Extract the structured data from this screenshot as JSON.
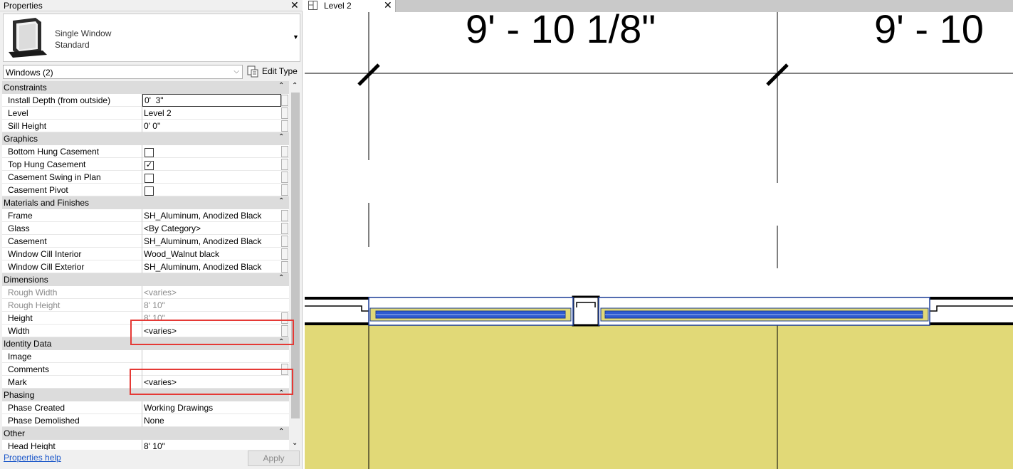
{
  "properties_panel": {
    "title": "Properties",
    "type_selector": {
      "name_line1": "Single Window",
      "name_line2": "Standard",
      "thumbnail_icon": "window-thumbnail-icon"
    },
    "category_filter": "Windows (2)",
    "edit_type_label": "Edit Type",
    "groups": {
      "constraints": "Constraints",
      "graphics": "Graphics",
      "materials": "Materials and Finishes",
      "dimensions": "Dimensions",
      "identity": "Identity Data",
      "phasing": "Phasing",
      "other": "Other"
    },
    "rows": {
      "install_depth": {
        "label": "Install Depth (from outside)",
        "value": "0'  3\""
      },
      "level": {
        "label": "Level",
        "value": "Level 2"
      },
      "sill_height": {
        "label": "Sill Height",
        "value": "0'  0\""
      },
      "bottom_hung": {
        "label": "Bottom Hung Casement",
        "checked": false
      },
      "top_hung": {
        "label": "Top Hung Casement",
        "checked": true
      },
      "casement_swing": {
        "label": "Casement Swing in Plan",
        "checked": false
      },
      "casement_pivot": {
        "label": "Casement Pivot",
        "checked": false
      },
      "frame": {
        "label": "Frame",
        "value": "SH_Aluminum, Anodized Black"
      },
      "glass": {
        "label": "Glass",
        "value": "<By Category>"
      },
      "casement": {
        "label": "Casement",
        "value": "SH_Aluminum, Anodized Black"
      },
      "cill_interior": {
        "label": "Window Cill Interior",
        "value": "Wood_Walnut black"
      },
      "cill_exterior": {
        "label": "Window Cill Exterior",
        "value": "SH_Aluminum, Anodized Black"
      },
      "rough_width": {
        "label": "Rough Width",
        "value": "<varies>"
      },
      "rough_height": {
        "label": "Rough Height",
        "value": "8'  10\""
      },
      "height": {
        "label": "Height",
        "value": "8'  10\""
      },
      "width": {
        "label": "Width",
        "value": "<varies>"
      },
      "image": {
        "label": "Image",
        "value": ""
      },
      "comments": {
        "label": "Comments",
        "value": ""
      },
      "mark": {
        "label": "Mark",
        "value": "<varies>"
      },
      "phase_created": {
        "label": "Phase Created",
        "value": "Working Drawings"
      },
      "phase_demolished": {
        "label": "Phase Demolished",
        "value": "None"
      },
      "head_height": {
        "label": "Head Height",
        "value": "8'  10\""
      }
    },
    "help_link": "Properties help",
    "apply_label": "Apply",
    "highlight_color": "#e53935"
  },
  "view": {
    "tab_title": "Level 2",
    "tab_icon": "floor-plan-icon",
    "dimension_1": "9' - 10 1/8\"",
    "dimension_2": "9' - 10",
    "colors": {
      "fill": "#e1d977",
      "glass": "#2f5bd0",
      "frame": "#1a3c96",
      "wall": "#000000"
    }
  }
}
